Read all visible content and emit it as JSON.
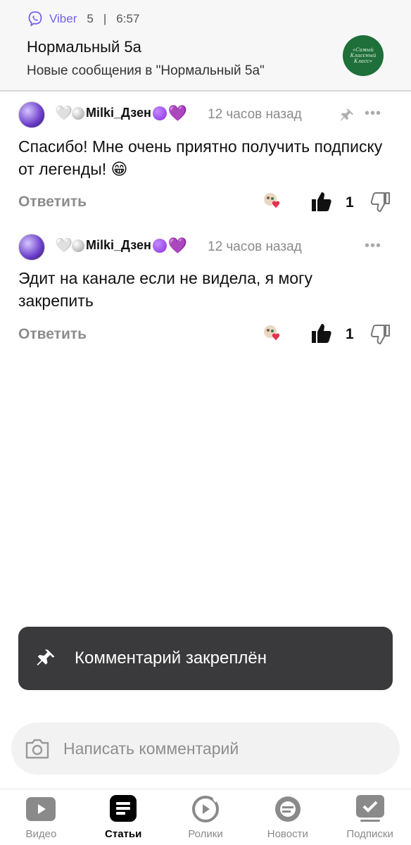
{
  "notification": {
    "app": "Viber",
    "count": "5",
    "separator": "|",
    "time": "6:57",
    "title": "Нормальный 5а",
    "text": "Новые сообщения в \"Нормальный 5а\"",
    "avatar_text": "«Самый Классный Класс»"
  },
  "comments": [
    {
      "author": "Milki_Дзен",
      "time": "12 часов назад",
      "text": "Спасибо! Мне очень приятно получить подписку от легенды! 😁",
      "reply_label": "Ответить",
      "likes": "1",
      "pinned": true
    },
    {
      "author": "Milki_Дзен",
      "time": "12 часов назад",
      "text": "Эдит на канале если не видела, я могу закрепить",
      "reply_label": "Ответить",
      "likes": "1",
      "pinned": false
    }
  ],
  "emoji": {
    "white_heart": "🤍",
    "purple_heart": "💜"
  },
  "more_dots": "•••",
  "toast": {
    "text": "Комментарий закреплён"
  },
  "composer": {
    "placeholder": "Написать комментарий"
  },
  "nav": {
    "items": [
      {
        "label": "Видео",
        "icon": "video-icon",
        "active": false
      },
      {
        "label": "Статьи",
        "icon": "articles-icon",
        "active": true
      },
      {
        "label": "Ролики",
        "icon": "shorts-icon",
        "active": false
      },
      {
        "label": "Новости",
        "icon": "news-icon",
        "active": false
      },
      {
        "label": "Подписки",
        "icon": "subscriptions-icon",
        "active": false
      }
    ]
  },
  "colors": {
    "viber": "#7360f2",
    "toast_bg": "#3a3a3c",
    "muted": "#8a8a8a"
  }
}
